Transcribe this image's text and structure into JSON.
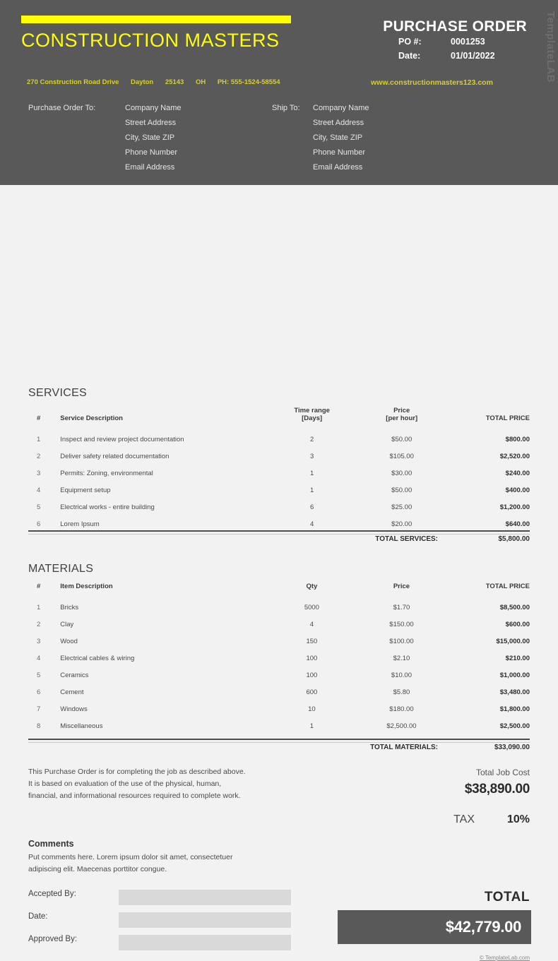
{
  "header": {
    "company_name": "CONSTRUCTION MASTERS",
    "doc_title": "PURCHASE ORDER",
    "po_number_label": "PO #:",
    "po_number_value": "0001253",
    "date_label": "Date:",
    "date_value": "01/01/2022",
    "address": {
      "street": "270 Construction Road Drive",
      "city": "Dayton",
      "zip": "25143",
      "state": "OH",
      "phone": "PH: 555-1524-58554"
    },
    "website": "www.constructionmasters123.com",
    "bill_to": {
      "label": "Purchase Order To:",
      "lines": [
        "Company Name",
        "Street Address",
        "City,  State ZIP",
        "Phone Number",
        "Email Address"
      ]
    },
    "ship_to": {
      "label": "Ship To:",
      "lines": [
        "Company Name",
        "Street Address",
        "City, State ZIP",
        "Phone Number",
        "Email Address"
      ]
    },
    "watermark": "TemplateLAB",
    "accent_yellow": "#ffff00",
    "band_color": "#595959"
  },
  "services": {
    "section_title": "SERVICES",
    "columns": {
      "num": "#",
      "description": "Service Description",
      "mid1_main": "Time range",
      "mid1_sub": "[Days]",
      "mid2_main": "Price",
      "mid2_sub": "[per hour]",
      "total": "TOTAL PRICE"
    },
    "rows": [
      {
        "num": "1",
        "description": "Inspect and review project documentation",
        "days": "2",
        "price": "$50.00",
        "total": "$800.00"
      },
      {
        "num": "2",
        "description": "Deliver safety related documentation",
        "days": "3",
        "price": "$105.00",
        "total": "$2,520.00"
      },
      {
        "num": "3",
        "description": "Permits: Zoning, environmental",
        "days": "1",
        "price": "$30.00",
        "total": "$240.00"
      },
      {
        "num": "4",
        "description": "Equipment setup",
        "days": "1",
        "price": "$50.00",
        "total": "$400.00"
      },
      {
        "num": "5",
        "description": "Electrical works - entire building",
        "days": "6",
        "price": "$25.00",
        "total": "$1,200.00"
      },
      {
        "num": "6",
        "description": "Lorem Ipsum",
        "days": "4",
        "price": "$20.00",
        "total": "$640.00"
      }
    ],
    "total_label": "TOTAL SERVICES:",
    "total_value": "$5,800.00"
  },
  "materials": {
    "section_title": "MATERIALS",
    "columns": {
      "num": "#",
      "description": "Item Description",
      "qty": "Qty",
      "price": "Price",
      "total": "TOTAL PRICE"
    },
    "rows": [
      {
        "num": "1",
        "description": "Bricks",
        "qty": "5000",
        "price": "$1.70",
        "total": "$8,500.00"
      },
      {
        "num": "2",
        "description": "Clay",
        "qty": "4",
        "price": "$150.00",
        "total": "$600.00"
      },
      {
        "num": "3",
        "description": "Wood",
        "qty": "150",
        "price": "$100.00",
        "total": "$15,000.00"
      },
      {
        "num": "4",
        "description": "Electrical cables & wiring",
        "qty": "100",
        "price": "$2.10",
        "total": "$210.00"
      },
      {
        "num": "5",
        "description": "Ceramics",
        "qty": "100",
        "price": "$10.00",
        "total": "$1,000.00"
      },
      {
        "num": "6",
        "description": "Cement",
        "qty": "600",
        "price": "$5.80",
        "total": "$3,480.00"
      },
      {
        "num": "7",
        "description": "Windows",
        "qty": "10",
        "price": "$180.00",
        "total": "$1,800.00"
      },
      {
        "num": "8",
        "description": "Miscellaneous",
        "qty": "1",
        "price": "$2,500.00",
        "total": "$2,500.00"
      }
    ],
    "total_label": "TOTAL MATERIALS:",
    "total_value": "$33,090.00"
  },
  "summary": {
    "note_line1": "This Purchase Order is for completing the job as described above.",
    "note_line2": "It is based on evaluation of the use of the physical, human,",
    "note_line3": "financial, and informational resources required to complete work.",
    "job_cost_label": "Total Job Cost",
    "job_cost_value": "$38,890.00",
    "tax_label": "TAX",
    "tax_value": "10%",
    "comments_title": "Comments",
    "comments_line1": "Put comments here. Lorem ipsum dolor sit amet, consectetuer",
    "comments_line2": "adipiscing elit. Maecenas porttitor congue.",
    "total_label": "TOTAL",
    "total_value": "$42,779.00"
  },
  "signature": {
    "accepted_by_label": "Accepted By:",
    "accepted_by_value": "",
    "date_label": "Date:",
    "date_value": "",
    "approved_by_label": "Approved By:",
    "approved_by_value": ""
  },
  "footer": {
    "credit": "© TemplateLab.com"
  }
}
